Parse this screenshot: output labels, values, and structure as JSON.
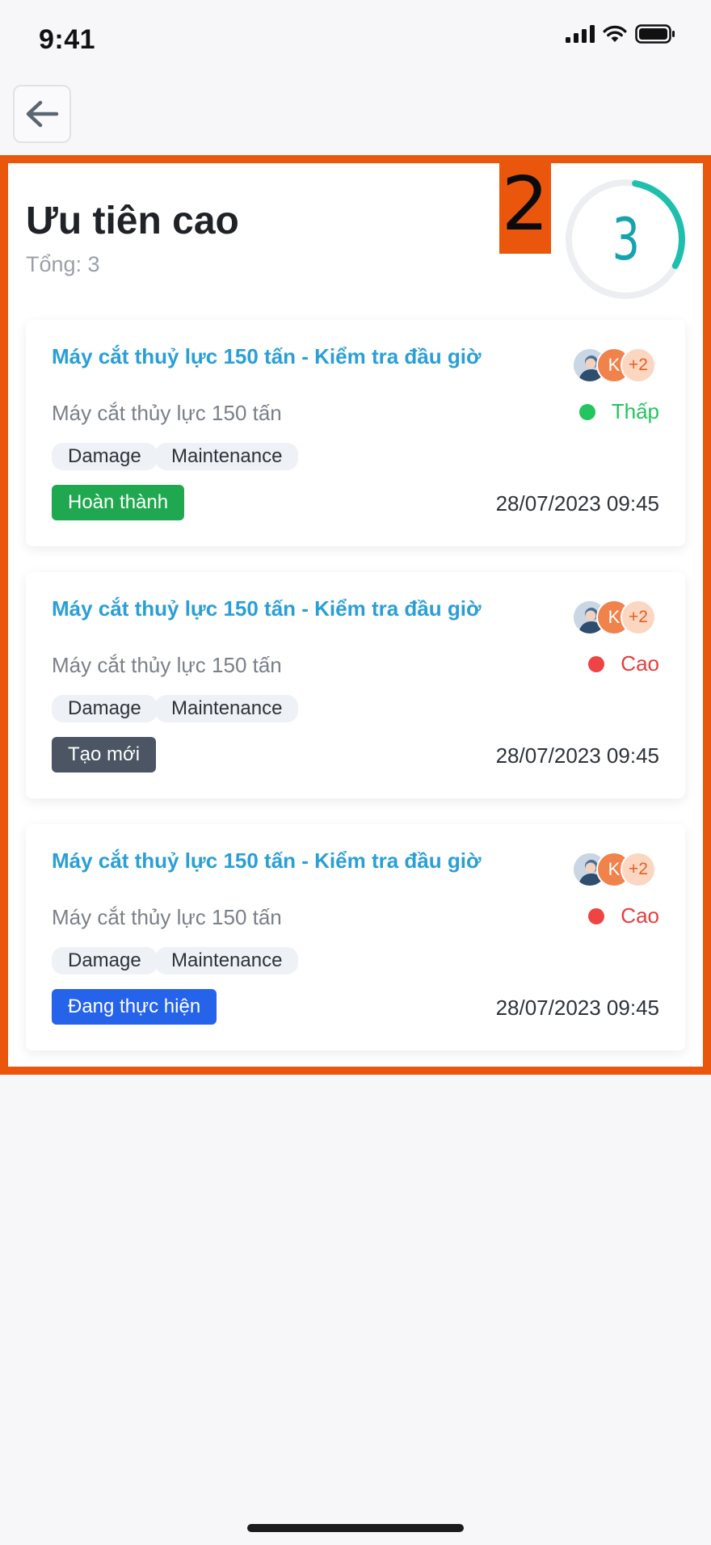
{
  "status_bar": {
    "time": "9:41"
  },
  "header": {
    "back_icon": "arrow-left-icon"
  },
  "highlight_number": "2",
  "section": {
    "title": "Ưu tiên cao",
    "total": "Tổng: 3",
    "ring_value": "3",
    "ring_progress": 0.3
  },
  "colors": {
    "accent_blue": "#2a9fd6",
    "highlight_orange": "#e9560c",
    "ring_teal": "#1fbfae",
    "priority_low": "#22c55e",
    "priority_high": "#ef4444",
    "status_done": "#1fa84f",
    "status_new": "#4b5563",
    "status_progress": "#2563eb"
  },
  "cards": [
    {
      "title": "Máy cắt thuỷ lực 150 tấn - Kiểm tra đầu giờ",
      "subtitle": "Máy cắt thủy lực 150 tấn",
      "priority": "Thấp",
      "tags": [
        "Damage",
        "Maintenance"
      ],
      "status": "Hoàn thành",
      "date": "28/07/2023 09:45",
      "avatar_initial": "K",
      "avatar_more": "+2"
    },
    {
      "title": "Máy cắt thuỷ lực 150 tấn - Kiểm tra đầu giờ",
      "subtitle": "Máy cắt thủy lực 150 tấn",
      "priority": "Cao",
      "tags": [
        "Damage",
        "Maintenance"
      ],
      "status": "Tạo mới",
      "date": "28/07/2023 09:45",
      "avatar_initial": "K",
      "avatar_more": "+2"
    },
    {
      "title": "Máy cắt thuỷ lực 150 tấn - Kiểm tra đầu giờ",
      "subtitle": "Máy cắt thủy lực 150 tấn",
      "priority": "Cao",
      "tags": [
        "Damage",
        "Maintenance"
      ],
      "status": "Đang thực hiện",
      "date": "28/07/2023 09:45",
      "avatar_initial": "K",
      "avatar_more": "+2"
    }
  ]
}
